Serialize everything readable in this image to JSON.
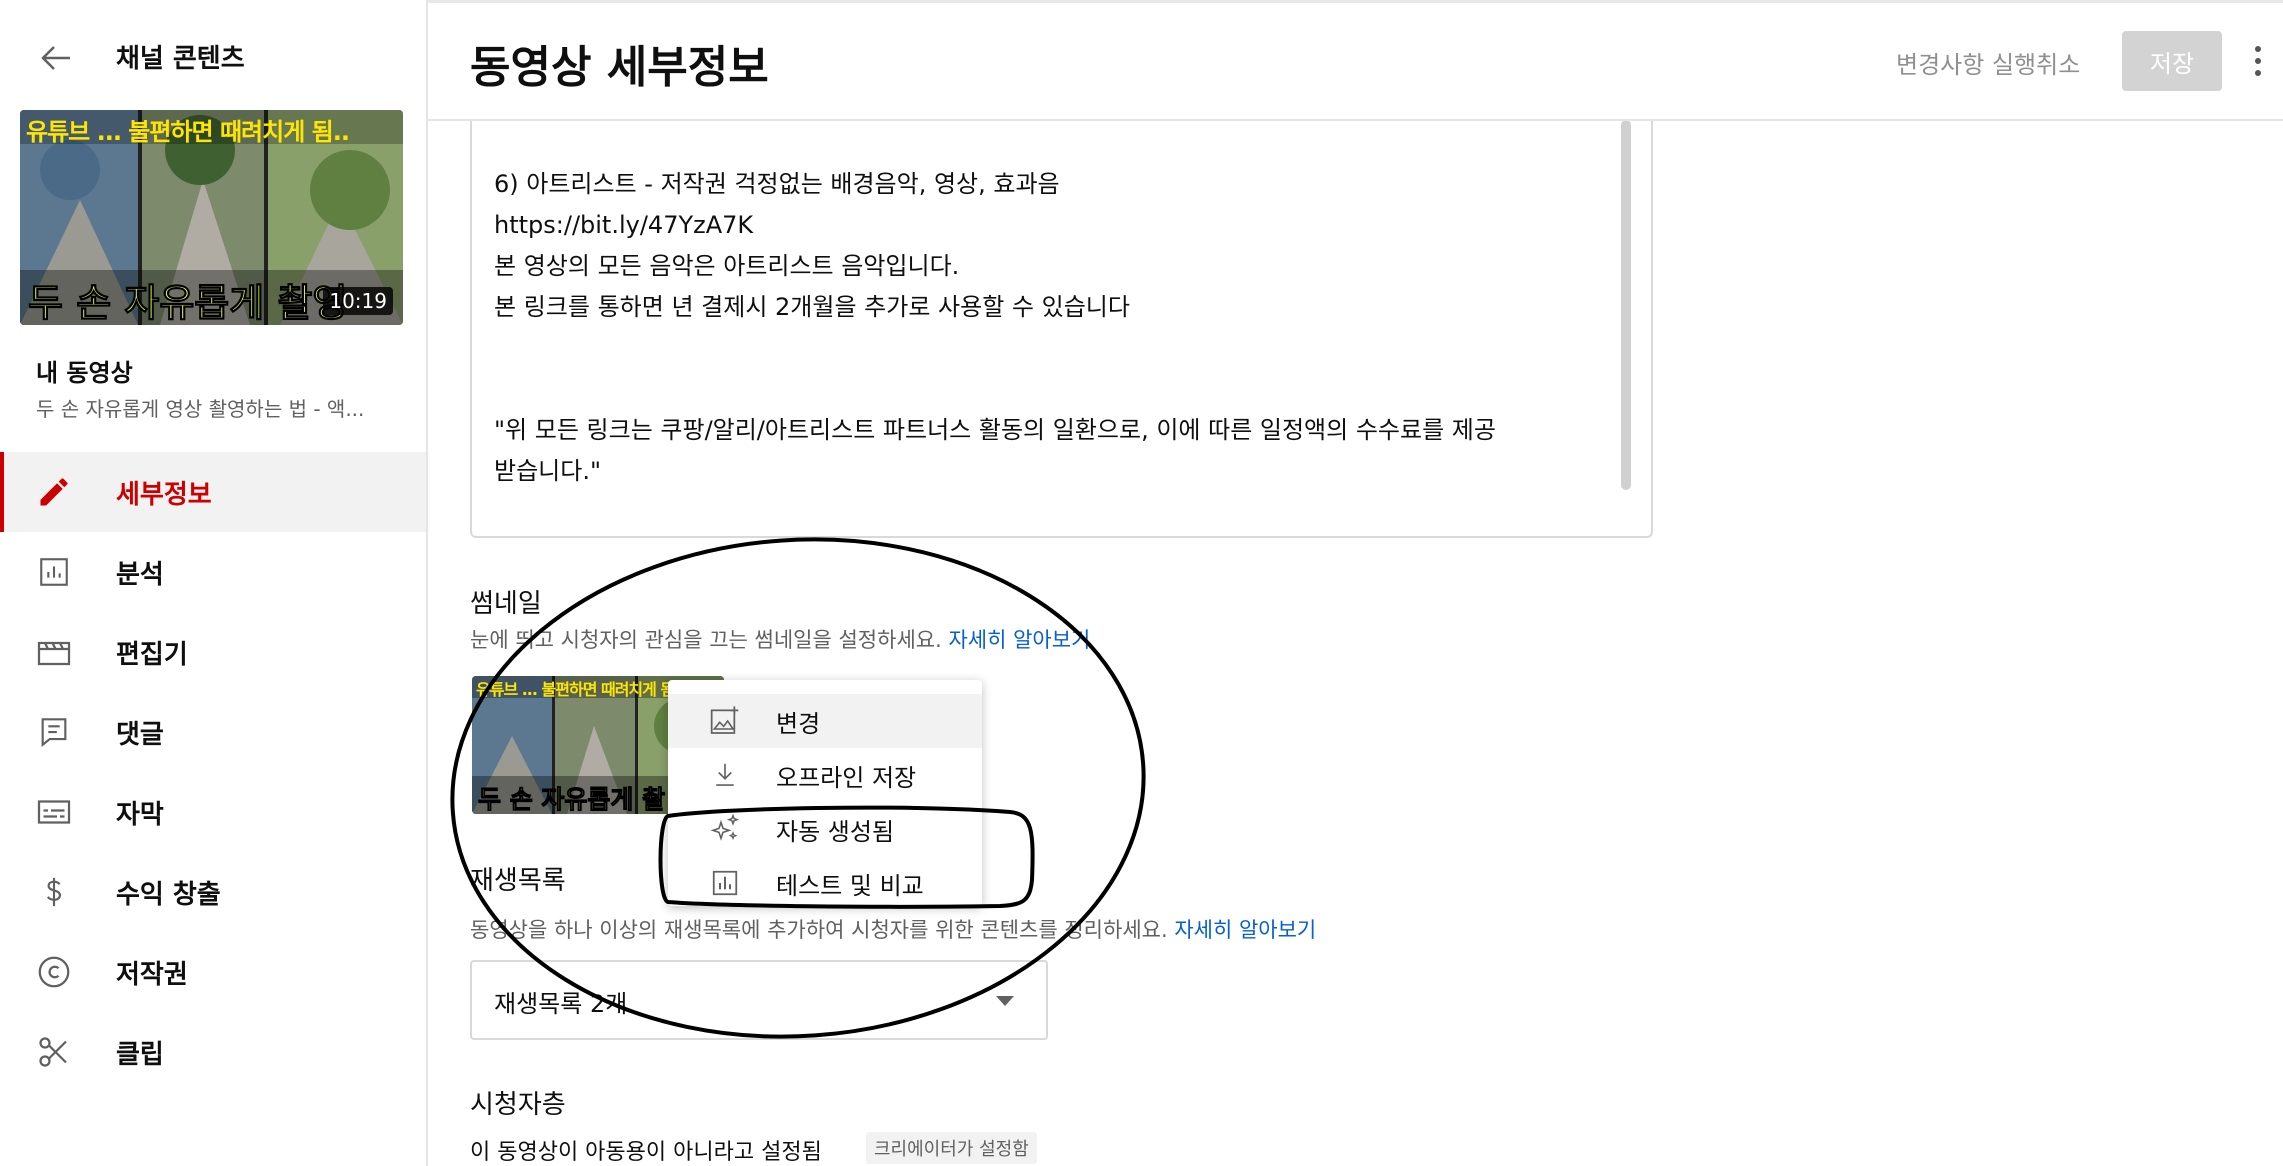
{
  "sidebar": {
    "channel_title": "채널 콘텐츠",
    "thumbnail": {
      "top_text": "유튜브 ... 불편하면 때려치게 됨..",
      "bottom_text": "두 손 자유롭게 촬영",
      "duration": "10:19"
    },
    "my_video_label": "내 동영상",
    "video_title": "두 손 자유롭게 영상 촬영하는 법 - 액...",
    "items": [
      {
        "label": "세부정보",
        "icon": "pencil-icon",
        "active": true
      },
      {
        "label": "분석",
        "icon": "analytics-icon"
      },
      {
        "label": "편집기",
        "icon": "clapper-icon"
      },
      {
        "label": "댓글",
        "icon": "comment-icon"
      },
      {
        "label": "자막",
        "icon": "subtitles-icon"
      },
      {
        "label": "수익 창출",
        "icon": "dollar-icon"
      },
      {
        "label": "저작권",
        "icon": "copyright-icon"
      },
      {
        "label": "클립",
        "icon": "scissors-icon"
      }
    ],
    "accent_color": "#cc0000"
  },
  "header": {
    "title": "동영상 세부정보",
    "undo_label": "변경사항 실행취소",
    "save_label": "저장"
  },
  "description": {
    "text": "6) 아트리스트 - 저작권 걱정없는 배경음악, 영상, 효과음\nhttps://bit.ly/47YzA7K\n본 영상의 모든 음악은 아트리스트 음악입니다.\n본 링크를 통하면 년 결제시 2개월을 추가로 사용할 수 있습니다\n\n\n\"위 모든 링크는 쿠팡/알리/아트리스트 파트너스 활동의 일환으로, 이에 따른 일정액의 수수료를 제공\n받습니다.\""
  },
  "thumbnail_section": {
    "title": "썸네일",
    "subtitle": "눈에 띄고 시청자의 관심을 끄는 썸네일을 설정하세요.",
    "learn_more": "자세히 알아보기",
    "thumb_top_text": "유튜브 ... 불편하면 때려치게 됨",
    "thumb_bottom_text": "두 손 자유롭게 촬"
  },
  "thumbnail_menu": {
    "items": [
      {
        "label": "변경",
        "icon": "image-add-icon"
      },
      {
        "label": "오프라인 저장",
        "icon": "download-icon"
      },
      {
        "label": "자동 생성됨",
        "icon": "sparkle-icon"
      },
      {
        "label": "테스트 및 비교",
        "icon": "analytics-icon"
      }
    ]
  },
  "playlist_section": {
    "title": "재생목록",
    "subtitle": "동영상을 하나 이상의 재생목록에 추가하여 시청자를 위한 콘텐츠를 정리하세요.",
    "learn_more": "자세히 알아보기",
    "selected": "재생목록 2개"
  },
  "audience_section": {
    "title": "시청자층",
    "status": "이 동영상이 아동용이 아니라고 설정됨",
    "badge": "크리에이터가 설정함"
  }
}
